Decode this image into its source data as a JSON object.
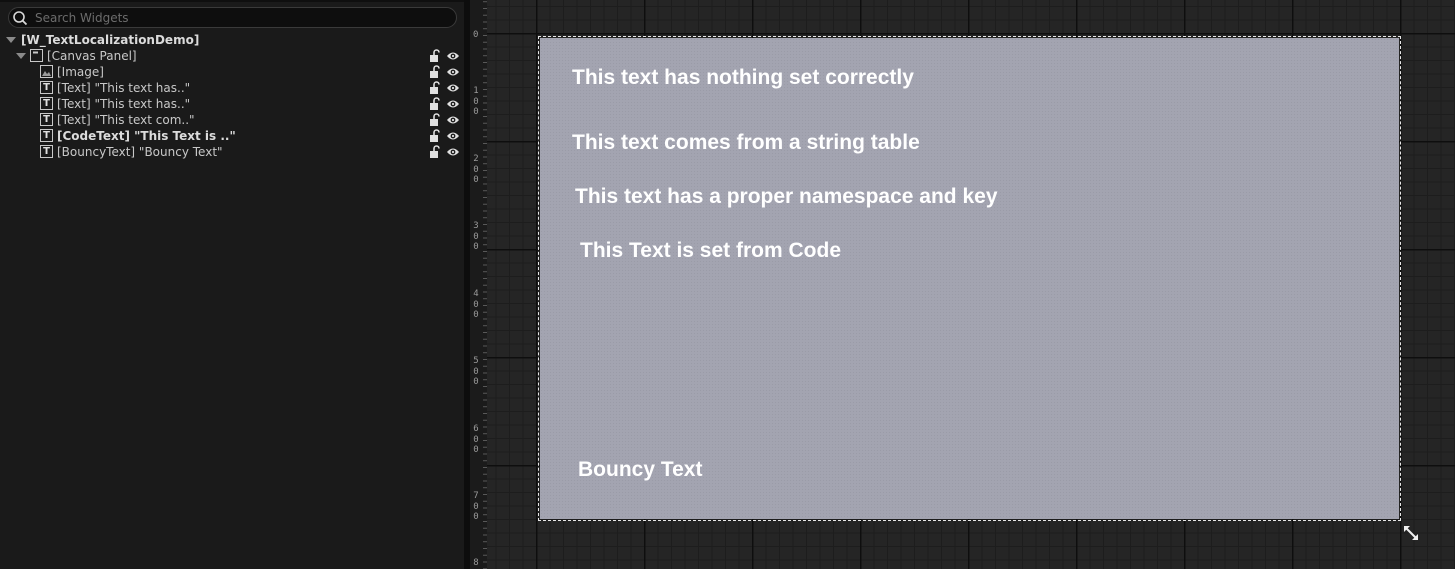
{
  "search": {
    "placeholder": "Search Widgets",
    "value": ""
  },
  "hierarchy": {
    "root": "[W_TextLocalizationDemo]",
    "canvas_panel": "[Canvas Panel]",
    "items": [
      {
        "label": "[Image]",
        "type": "image",
        "bold": false
      },
      {
        "label": "[Text] \"This text has..\"",
        "type": "text",
        "bold": false
      },
      {
        "label": "[Text] \"This text has..\"",
        "type": "text",
        "bold": false
      },
      {
        "label": "[Text] \"This text com..\"",
        "type": "text",
        "bold": false
      },
      {
        "label": "[CodeText] \"This Text is ..\"",
        "type": "text",
        "bold": true
      },
      {
        "label": "[BouncyText] \"Bouncy Text\"",
        "type": "text",
        "bold": false
      }
    ],
    "icons": {
      "lock": "unlock-icon",
      "visibility": "eye-icon"
    }
  },
  "ruler": {
    "zero": "0",
    "labels": [
      "1\n0\n0",
      "2\n0\n0",
      "3\n0\n0",
      "4\n0\n0",
      "5\n0\n0",
      "6\n0\n0",
      "7\n0\n0",
      "8"
    ]
  },
  "canvas": {
    "texts": [
      "This text has nothing set correctly",
      "This text comes from a string table",
      "This text has a proper namespace and key",
      "This Text is set from Code",
      "Bouncy Text"
    ],
    "background": "#a3a4b1"
  },
  "colors": {
    "panel_bg": "#1a1a1a",
    "designer_grid": "#252525",
    "canvas_text": "#ffffff"
  }
}
